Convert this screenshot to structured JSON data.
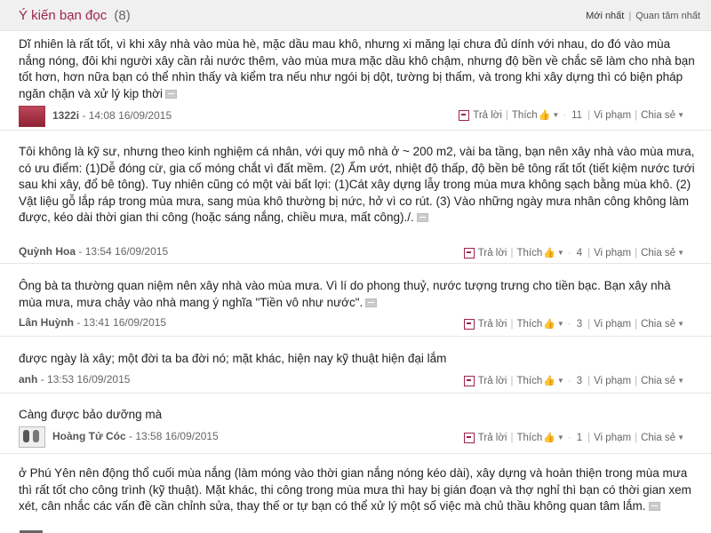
{
  "header": {
    "title": "Ý kiến bạn đọc",
    "count": "(8)",
    "sort_newest": "Mới nhất",
    "sort_popular": "Quan tâm nhất"
  },
  "actions": {
    "reply": "Trả lời",
    "like": "Thích",
    "report": "Vi phạm",
    "share": "Chia sẻ"
  },
  "comments": [
    {
      "text": "Dĩ nhiên là rất tốt, vì khi xây nhà vào mùa hè, mặc dầu mau khô, nhưng xi măng lại chưa đủ dính với nhau, do đó vào mùa nắng nóng, đôi khi người xây cần rải nước thêm, vào mùa mưa mặc dầu khô chậm, nhưng độ bền về chắc sẽ làm cho nhà bạn tốt hơn, hơn nữa bạn có thể nhìn thấy và kiểm tra nếu như ngói bị dột, tường bị thấm, và trong khi xây dựng thì có biện pháp ngăn chặn và xử lý kịp thời",
      "author": "1322i",
      "time": "- 14:08 16/09/2015",
      "likes": "11"
    },
    {
      "text": "Tôi không là kỹ sư, nhưng theo kinh nghiệm cá nhân, với quy mô nhà ở ~ 200 m2, vài ba tầng, bạn nên xây nhà vào mùa mưa, có ưu điểm: (1)Dễ đóng cừ, gia cố móng chắt vì đất mềm. (2) Ẩm ướt, nhiệt độ thấp, độ bền bê tông rất tốt (tiết kiệm nước tưới sau khi xây, đổ bê tông). Tuy nhiên cũng có một vài bất lợi: (1)Cát xây dựng lẫy trong mùa mưa không sạch bằng mùa khô. (2) Vật liệu gỗ lắp ráp trong mùa mưa, sang mùa khô thường bị nức, hở vì co rút. (3) Vào những ngày mưa nhân công không làm được, kéo dài thời gian thi công (hoặc sáng nắng, chiều mưa, mất công)./.",
      "author": "Quỳnh Hoa",
      "time": "- 13:54 16/09/2015",
      "likes": "4"
    },
    {
      "text": "Ông bà ta thường quan niệm nên xây nhà vào mùa mưa. Vì lí do phong thuỷ, nước tượng trưng cho tiền bạc. Bạn xây nhà mùa mưa, mưa chảy vào nhà mang ý nghĩa \"Tiền vô như nước\".",
      "author": "Lân Huỳnh",
      "time": "- 13:41 16/09/2015",
      "likes": "3"
    },
    {
      "text": "được ngày là xây; một đời ta ba đời nó; mặt khác, hiện nay kỹ thuật hiện đại lắm",
      "author": "anh",
      "time": "- 13:53 16/09/2015",
      "likes": "3"
    },
    {
      "text": "Càng được bảo dưỡng mà",
      "author": "Hoàng Tử Cóc",
      "time": "- 13:58 16/09/2015",
      "likes": "1"
    },
    {
      "text": "ở Phú Yên nên động thổ cuối mùa nắng (làm móng vào thời gian nắng nóng kéo dài), xây dựng và hoàn thiện trong mùa mưa thì rất tốt cho công trình (kỹ thuật). Mặt khác, thi công trong mùa mưa thì hay bị gián đoạn và thợ nghỉ thì bạn có thời gian xem xét, cân nhắc các vấn đề cần chỉnh sửa, thay thế or tự bạn có thể xử lý một số việc mà chủ thầu không quan tâm lắm."
    }
  ]
}
